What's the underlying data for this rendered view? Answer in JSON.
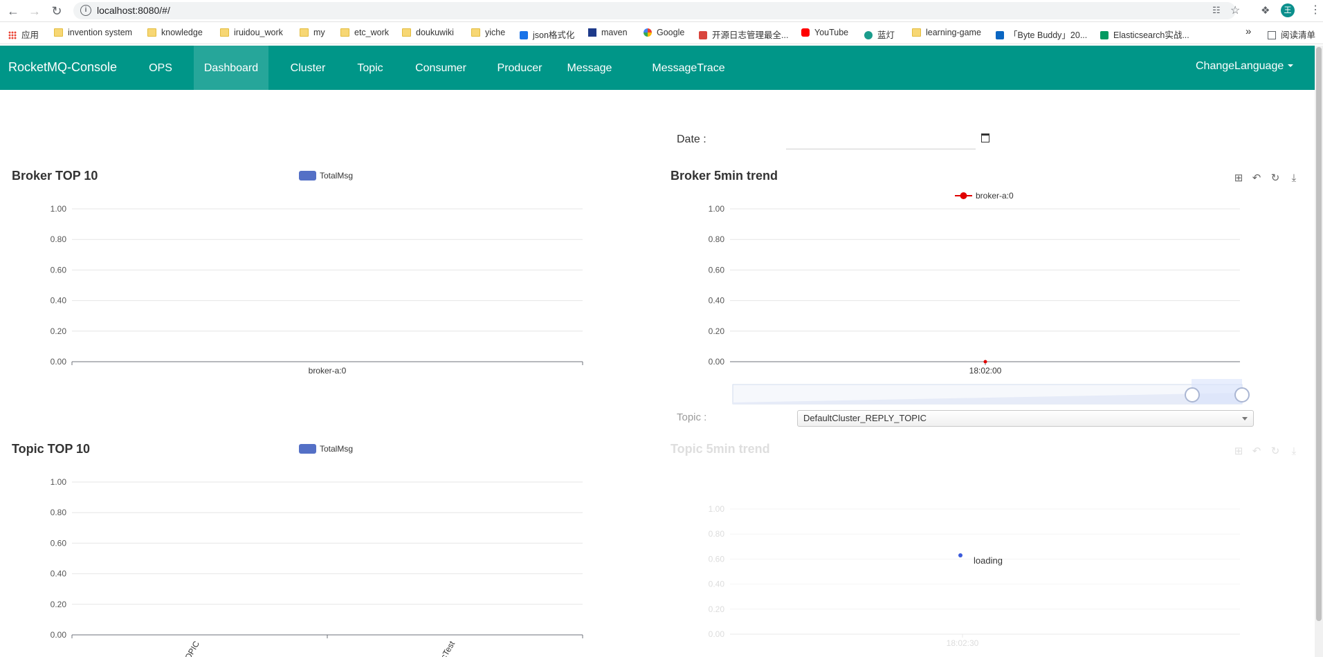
{
  "browser": {
    "url": "localhost:8080/#/",
    "profile_initial": "王",
    "bookmarks": [
      {
        "label": "应用",
        "icon": "apps-grid-icon"
      },
      {
        "label": "invention system",
        "icon": "folder-icon"
      },
      {
        "label": "knowledge",
        "icon": "folder-icon"
      },
      {
        "label": "iruidou_work",
        "icon": "folder-icon"
      },
      {
        "label": "my",
        "icon": "folder-icon"
      },
      {
        "label": "etc_work",
        "icon": "folder-icon"
      },
      {
        "label": "doukuwiki",
        "icon": "folder-icon"
      },
      {
        "label": "yiche",
        "icon": "folder-icon"
      },
      {
        "label": "json格式化",
        "icon": "json-icon"
      },
      {
        "label": "maven",
        "icon": "maven-icon"
      },
      {
        "label": "Google",
        "icon": "google-icon"
      },
      {
        "label": "开源日志管理最全...",
        "icon": "site-icon"
      },
      {
        "label": "YouTube",
        "icon": "youtube-icon"
      },
      {
        "label": "蓝灯",
        "icon": "lantern-icon"
      },
      {
        "label": "learning-game",
        "icon": "folder-icon"
      },
      {
        "label": "「Byte Buddy」20...",
        "icon": "zhihu-icon"
      },
      {
        "label": "Elasticsearch实战...",
        "icon": "sf-icon"
      }
    ],
    "overflow_label": "»",
    "reading_list_label": "阅读清单"
  },
  "navbar": {
    "brand": "RocketMQ-Console",
    "ops": "OPS",
    "items": [
      "Dashboard",
      "Cluster",
      "Topic",
      "Consumer",
      "Producer",
      "Message",
      "MessageTrace"
    ],
    "active": "Dashboard",
    "change_language": "ChangeLanguage",
    "accent_color": "#009688"
  },
  "date": {
    "label": "Date :",
    "value": ""
  },
  "topic_filter": {
    "label": "Topic :",
    "selected": "DefaultCluster_REPLY_TOPIC"
  },
  "panels": {
    "broker_top10": {
      "title": "Broker TOP 10"
    },
    "broker_trend": {
      "title": "Broker 5min trend"
    },
    "topic_top10": {
      "title": "Topic TOP 10"
    },
    "topic_trend": {
      "title": "Topic 5min trend",
      "loading_text": "loading"
    }
  },
  "chart_data": [
    {
      "type": "bar",
      "title": "Broker TOP 10",
      "legend": [
        "TotalMsg"
      ],
      "legend_position": "top-center",
      "categories": [
        "broker-a:0"
      ],
      "series": [
        {
          "name": "TotalMsg",
          "values": [
            0
          ]
        }
      ],
      "ylim": [
        0,
        1
      ],
      "yticks": [
        "1.00",
        "0.80",
        "0.60",
        "0.40",
        "0.20",
        "0.00"
      ],
      "color": "#5470c6",
      "grid": true
    },
    {
      "type": "line",
      "title": "Broker 5min trend",
      "legend": [
        "broker-a:0"
      ],
      "legend_position": "top-center",
      "x": [
        "18:02:00"
      ],
      "series": [
        {
          "name": "broker-a:0",
          "values": [
            0
          ]
        }
      ],
      "ylim": [
        0,
        1
      ],
      "yticks": [
        "1.00",
        "0.80",
        "0.60",
        "0.40",
        "0.20",
        "0.00"
      ],
      "color": "#e00000",
      "grid": true,
      "data_zoom": true
    },
    {
      "type": "bar",
      "title": "Topic TOP 10",
      "legend": [
        "TotalMsg"
      ],
      "legend_position": "top-center",
      "categories": [
        "OPIC",
        "cTest"
      ],
      "series": [
        {
          "name": "TotalMsg",
          "values": [
            0,
            0
          ]
        }
      ],
      "ylim": [
        0,
        1
      ],
      "yticks": [
        "1.00",
        "0.80",
        "0.60",
        "0.40",
        "0.20",
        "0.00"
      ],
      "color": "#5470c6",
      "grid": true
    },
    {
      "type": "line",
      "title": "Topic 5min trend",
      "x": [
        "18:02:30"
      ],
      "series": [],
      "ylim": [
        0,
        1
      ],
      "yticks": [
        "1.00",
        "0.80",
        "0.60",
        "0.40",
        "0.20",
        "0.00"
      ],
      "grid": true,
      "state": "loading"
    }
  ]
}
